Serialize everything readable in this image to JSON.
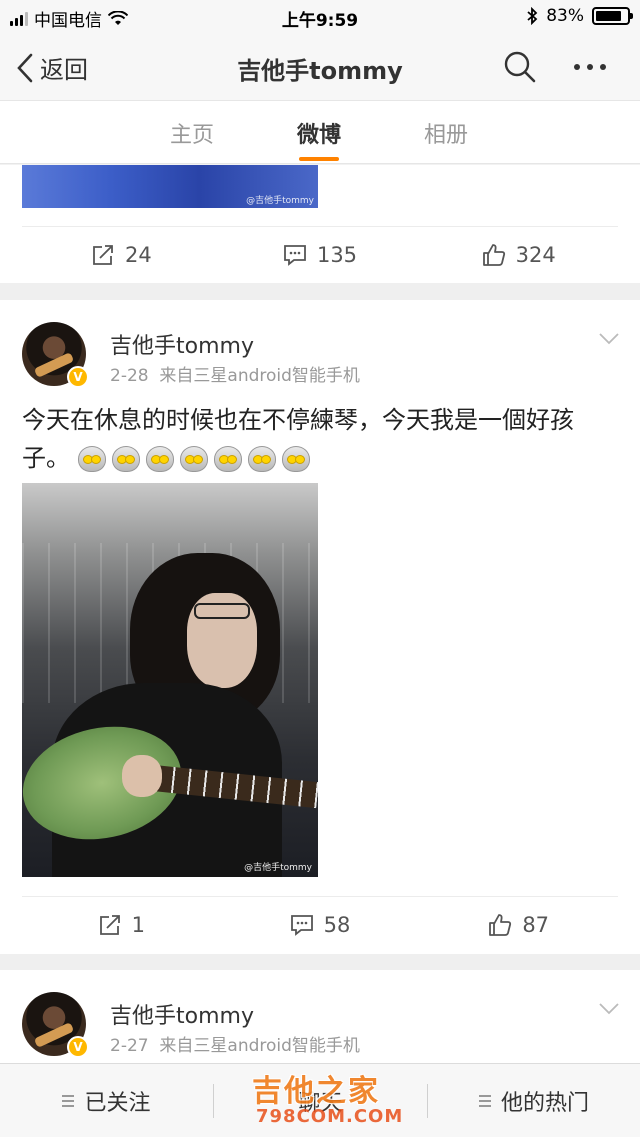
{
  "status_bar": {
    "carrier": "中国电信",
    "time": "上午9:59",
    "battery": "83%",
    "battery_level": 0.83
  },
  "nav": {
    "back_label": "返回",
    "title": "吉他手tommy"
  },
  "tabs": [
    {
      "label": "主页",
      "active": false
    },
    {
      "label": "微博",
      "active": true
    },
    {
      "label": "相册",
      "active": false
    }
  ],
  "posts": [
    {
      "image_watermark": "@吉他手tommy",
      "actions": {
        "repost": "24",
        "comment": "135",
        "like": "324"
      }
    },
    {
      "author": "吉他手tommy",
      "date": "2-28",
      "source": "来自三星android智能手机",
      "text": "今天在休息的时候也在不停練琴，今天我是一個好孩子。",
      "emoji_count": 7,
      "image_watermark": "@吉他手tommy",
      "actions": {
        "repost": "1",
        "comment": "58",
        "like": "87"
      }
    },
    {
      "author": "吉他手tommy",
      "date": "2-27",
      "source": "来自三星android智能手机"
    }
  ],
  "bottom_bar": {
    "follow": "已关注",
    "chat": "聊天",
    "hot": "他的热门"
  },
  "watermark": {
    "name": "吉他之家",
    "url": "798COM.COM"
  },
  "colors": {
    "accent": "#ff8200",
    "verified": "#ffb800"
  }
}
